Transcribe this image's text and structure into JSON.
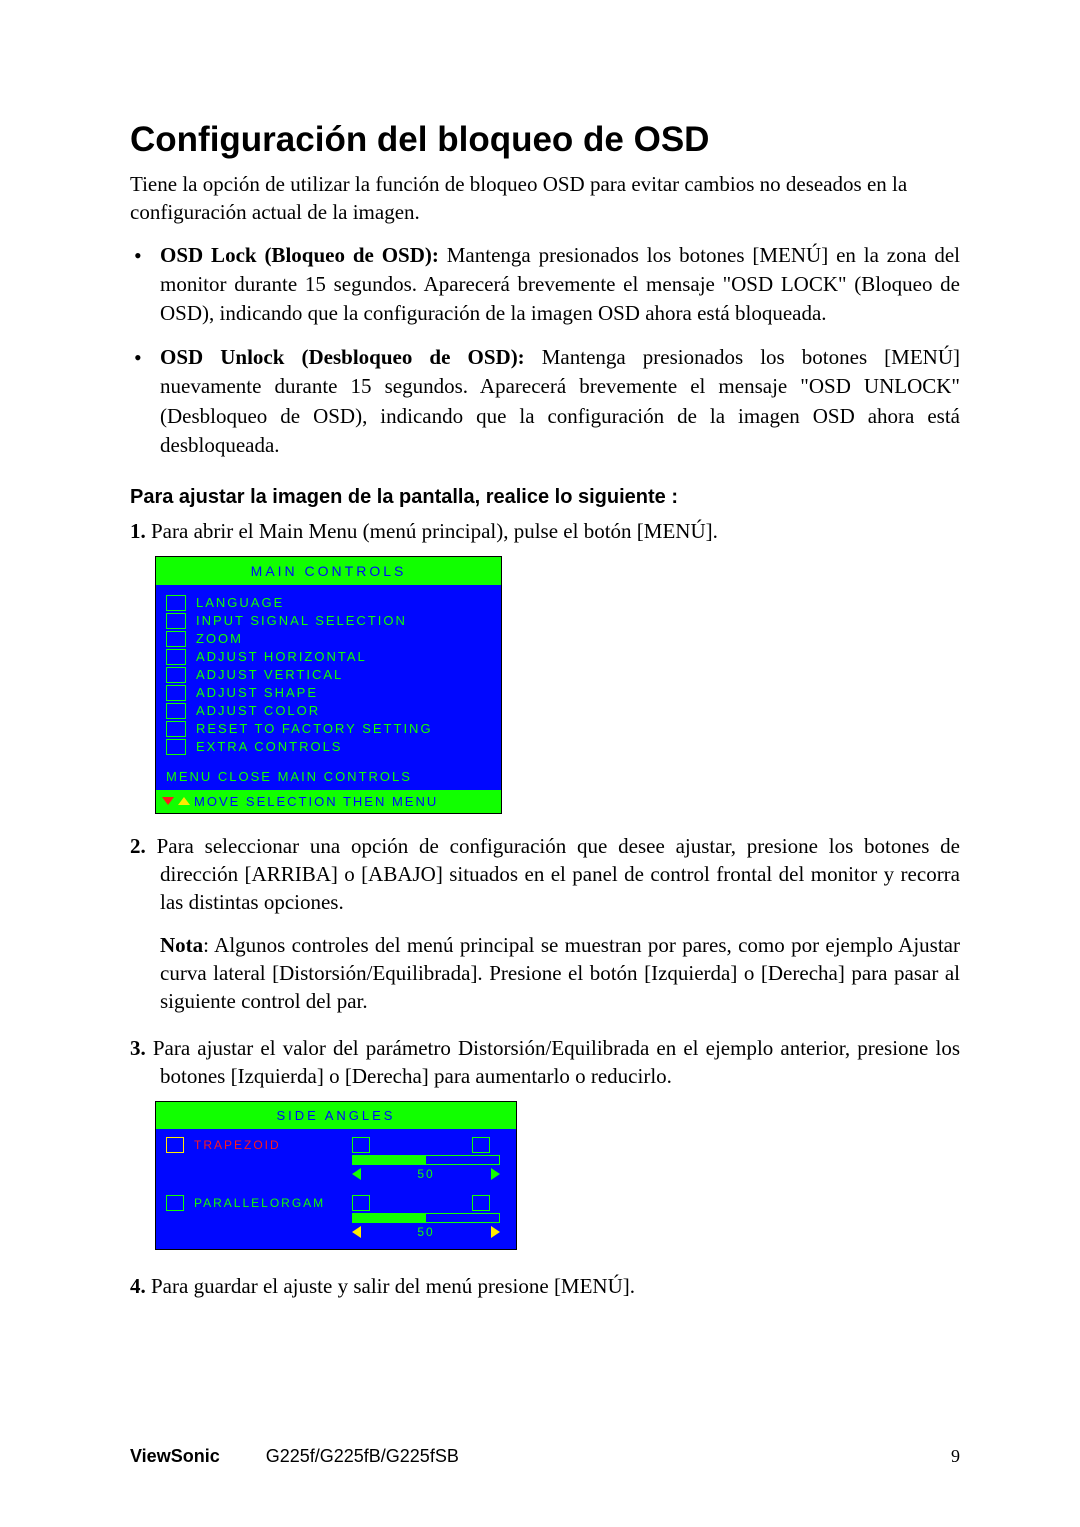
{
  "heading": "Configuración del bloqueo de OSD",
  "intro": "Tiene la opción de utilizar la función de bloqueo OSD para evitar cambios no deseados en la configuración actual de la imagen.",
  "bullets": [
    {
      "bold": "OSD Lock (Bloqueo de OSD):",
      "text": " Mantenga presionados los botones [MENÚ] en la zona del monitor durante 15 segundos. Aparecerá brevemente el mensaje \"OSD LOCK\" (Bloqueo de OSD), indicando que la configuración de la imagen OSD ahora está bloqueada."
    },
    {
      "bold": "OSD Unlock (Desbloqueo de OSD):",
      "text": " Mantenga presionados los botones [MENÚ] nuevamente durante 15 segundos. Aparecerá brevemente el mensaje \"OSD UNLOCK\" (Desbloqueo de OSD), indicando que la configuración de la imagen OSD ahora está desbloqueada."
    }
  ],
  "subheading": "Para ajustar la imagen de la pantalla, realice lo siguiente :",
  "steps": {
    "s1": "Para abrir el Main Menu (menú principal), pulse el botón [MENÚ].",
    "s2": "Para seleccionar una opción de configuración que desee ajustar, presione los botones de dirección [ARRIBA] o [ABAJO] situados en el panel de control frontal del monitor y recorra las distintas opciones.",
    "note_bold": "Nota",
    "note": ": Algunos controles del menú principal se muestran por pares, como por ejemplo Ajustar curva lateral [Distorsión/Equilibrada]. Presione el botón [Izquierda] o [Derecha] para pasar al siguiente control del par.",
    "s3": "Para ajustar el valor del parámetro Distorsión/Equilibrada en el ejemplo anterior, presione los botones [Izquierda] o [Derecha] para aumentarlo o reducirlo.",
    "s4": "Para guardar el ajuste y salir del menú presione [MENÚ]."
  },
  "osd1": {
    "title": "MAIN CONTROLS",
    "items": [
      "LANGUAGE",
      "INPUT SIGNAL SELECTION",
      "ZOOM",
      "ADJUST HORIZONTAL",
      "ADJUST VERTICAL",
      "ADJUST SHAPE",
      "ADJUST COLOR",
      "RESET TO FACTORY SETTING",
      "EXTRA CONTROLS"
    ],
    "close": "MENU  CLOSE MAIN CONTROLS",
    "foot": "MOVE SELECTION THEN MENU"
  },
  "osd2": {
    "title": "SIDE ANGLES",
    "rows": [
      {
        "name": "TRAPEZOID",
        "value": "50"
      },
      {
        "name": "PARALLELORGAM",
        "value": "50"
      }
    ]
  },
  "footer": {
    "brand": "ViewSonic",
    "model": "G225f/G225fB/G225fSB",
    "page": "9"
  }
}
